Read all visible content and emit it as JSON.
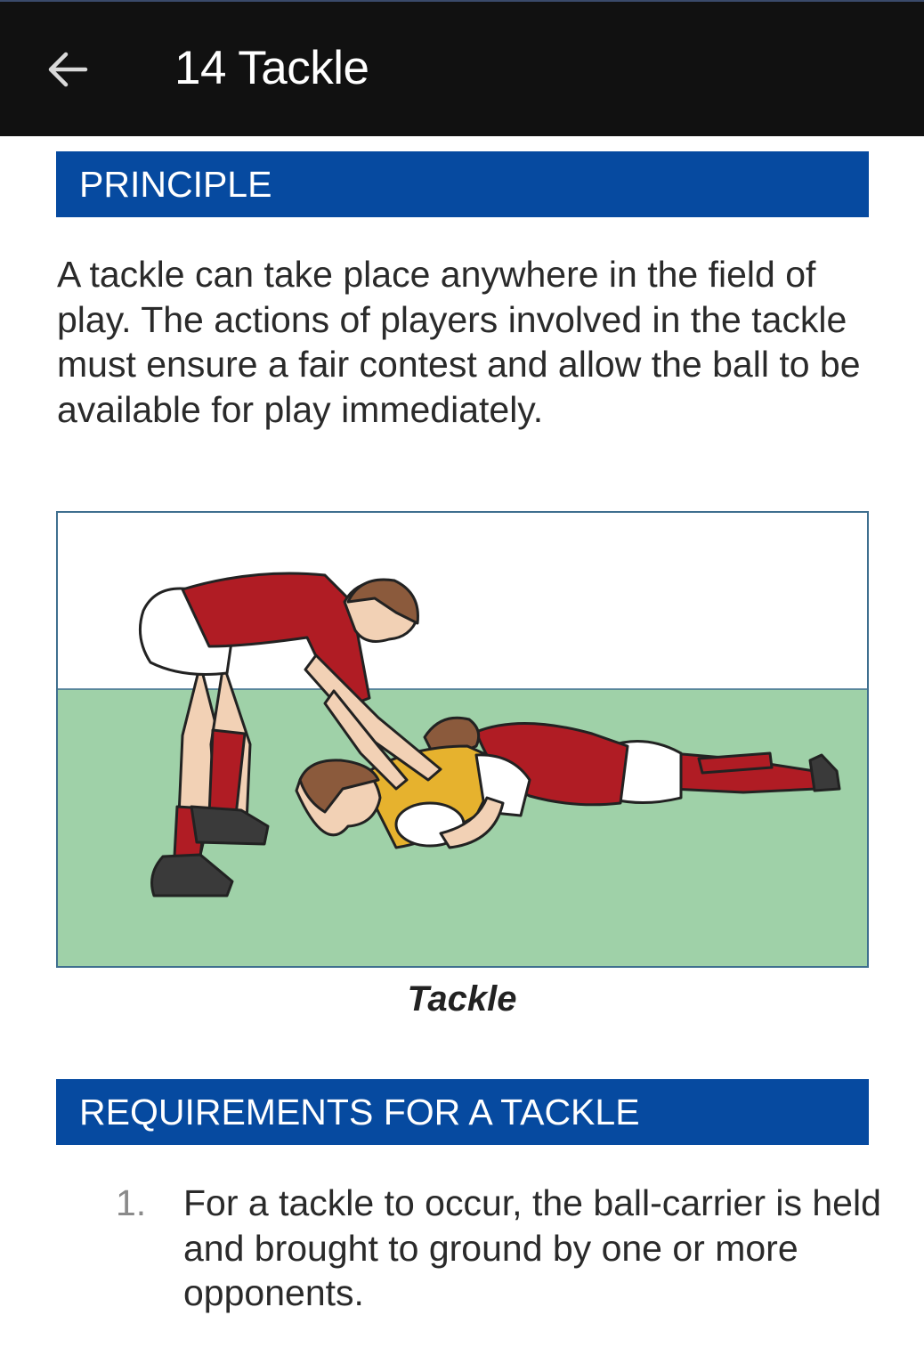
{
  "header": {
    "title": "14 Tackle"
  },
  "sections": {
    "principle": {
      "heading": "PRINCIPLE",
      "body": "A tackle can take place anywhere in the field of play. The actions of players involved in the tackle must ensure a fair contest and allow the ball to be available for play immediately."
    },
    "figure": {
      "caption": "Tackle"
    },
    "requirements": {
      "heading": "REQUIREMENTS FOR A TACKLE",
      "items": [
        {
          "number": "1.",
          "text": "For a tackle to occur, the ball-carrier is held and brought to ground by one or more opponents."
        }
      ]
    }
  },
  "icons": {
    "back": "arrow-left-icon"
  },
  "colors": {
    "appbar": "#111111",
    "section_bar": "#064aa0",
    "field_green": "#9fd1a8",
    "red_kit": "#b01c24",
    "yellow_kit": "#e6b22e"
  }
}
